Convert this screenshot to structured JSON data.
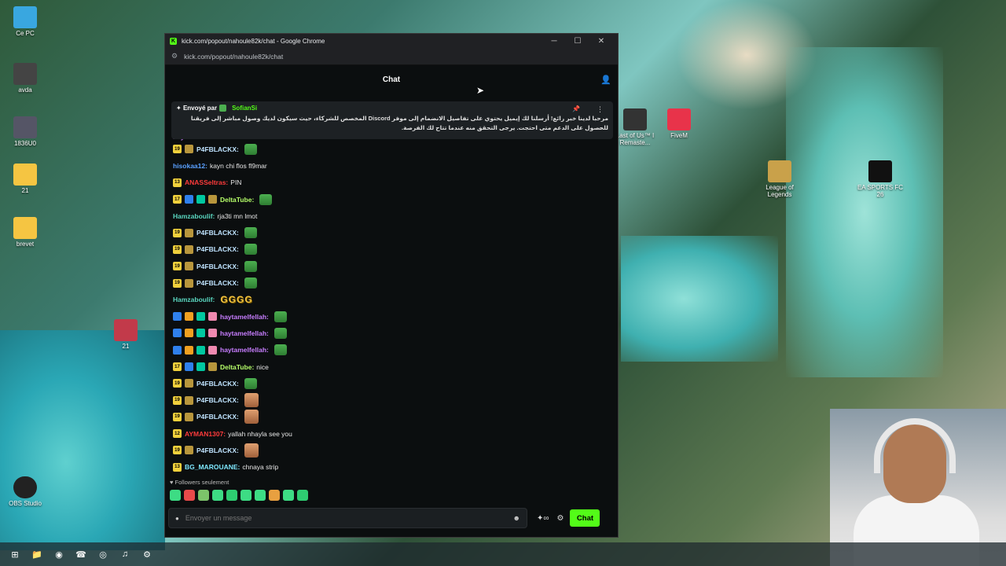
{
  "window": {
    "title": "kick.com/popout/nahoule82k/chat - Google Chrome",
    "url": "kick.com/popout/nahoule82k/chat",
    "minimize": "─",
    "maximize": "☐",
    "close": "✕"
  },
  "chat": {
    "header": "Chat",
    "pinned": {
      "label": "Envoyé par",
      "author": "SofianSi",
      "message": "مرحبا لدينا خبر رائع! أرسلنا لك إيميل يحتوي على تفاصيل الانضمام إلى موفر Discord المخصص للشركاء، حيث سيكون لديك وصول مباشر إلى فريقنا للحصول على الدعم متى احتجت. يرجى التحقق منه عندما تتاح لك الفرصة."
    },
    "partial_top_user": "haytamelfellah:",
    "messages": [
      {
        "user": "P4FBLACKX:",
        "text": "",
        "color": "#bfe3ff",
        "badges": [
          "b-sub:19",
          "b-leaf:"
        ],
        "emote": "pepe"
      },
      {
        "user": "hisokaa12:",
        "text": "kayn chi flos fl9mar",
        "color": "#5aa0ff",
        "badges": [],
        "emote": ""
      },
      {
        "user": "ANASSeltras:",
        "text": "PIN",
        "color": "#ff3b3b",
        "badges": [
          "b-sub:13"
        ],
        "emote": ""
      },
      {
        "user": "DeltaTube:",
        "text": "",
        "color": "#b6ff6a",
        "badges": [
          "b-sub:17",
          "b-ax:",
          "b-mod:",
          "b-leaf:"
        ],
        "emote": "pepe"
      },
      {
        "user": "Hamzaboulif:",
        "text": "rja3ti mn lmot",
        "color": "#5ad7c0",
        "badges": [],
        "emote": ""
      },
      {
        "user": "P4FBLACKX:",
        "text": "",
        "color": "#bfe3ff",
        "badges": [
          "b-sub:19",
          "b-leaf:"
        ],
        "emote": "pepe"
      },
      {
        "user": "P4FBLACKX:",
        "text": "",
        "color": "#bfe3ff",
        "badges": [
          "b-sub:19",
          "b-leaf:"
        ],
        "emote": "pepe"
      },
      {
        "user": "P4FBLACKX:",
        "text": "",
        "color": "#bfe3ff",
        "badges": [
          "b-sub:19",
          "b-leaf:"
        ],
        "emote": "pepe"
      },
      {
        "user": "P4FBLACKX:",
        "text": "",
        "color": "#bfe3ff",
        "badges": [
          "b-sub:19",
          "b-leaf:"
        ],
        "emote": "pepe"
      },
      {
        "user": "Hamzaboulif:",
        "text": "",
        "color": "#5ad7c0",
        "badges": [],
        "emote": "gggg",
        "emote_text": "GGGG"
      },
      {
        "user": "haytamelfellah:",
        "text": "",
        "color": "#c77dff",
        "badges": [
          "b-ax:",
          "b-crown:",
          "b-mod:",
          "b-gift:"
        ],
        "emote": "pepe"
      },
      {
        "user": "haytamelfellah:",
        "text": "",
        "color": "#c77dff",
        "badges": [
          "b-ax:",
          "b-crown:",
          "b-mod:",
          "b-gift:"
        ],
        "emote": "pepe"
      },
      {
        "user": "haytamelfellah:",
        "text": "",
        "color": "#c77dff",
        "badges": [
          "b-ax:",
          "b-crown:",
          "b-mod:",
          "b-gift:"
        ],
        "emote": "pepe"
      },
      {
        "user": "DeltaTube:",
        "text": "nice",
        "color": "#b6ff6a",
        "badges": [
          "b-sub:17",
          "b-ax:",
          "b-mod:",
          "b-leaf:"
        ],
        "emote": ""
      },
      {
        "user": "P4FBLACKX:",
        "text": "",
        "color": "#bfe3ff",
        "badges": [
          "b-sub:19",
          "b-leaf:"
        ],
        "emote": "pepe"
      },
      {
        "user": "P4FBLACKX:",
        "text": "",
        "color": "#bfe3ff",
        "badges": [
          "b-sub:19",
          "b-leaf:"
        ],
        "emote": "face"
      },
      {
        "user": "P4FBLACKX:",
        "text": "",
        "color": "#bfe3ff",
        "badges": [
          "b-sub:19",
          "b-leaf:"
        ],
        "emote": "face"
      },
      {
        "user": "AYMAN1307:",
        "text": "yallah nhayla see you",
        "color": "#ff3b3b",
        "badges": [
          "b-sub:12"
        ],
        "emote": ""
      },
      {
        "user": "P4FBLACKX:",
        "text": "",
        "color": "#bfe3ff",
        "badges": [
          "b-sub:19",
          "b-leaf:"
        ],
        "emote": "face"
      },
      {
        "user": "BG_MAROUANE:",
        "text": "chnaya strip",
        "color": "#7ee8ff",
        "badges": [
          "b-sub:13"
        ],
        "emote": ""
      }
    ],
    "followers_only": "Followers seulement",
    "input_placeholder": "Envoyer un message",
    "chat_button": "Chat",
    "emote_colors": [
      "#3ddc84",
      "#e84a4a",
      "#7cc36a",
      "#3ddc84",
      "#2ecc71",
      "#3ddc84",
      "#3ddc84",
      "#e8a040",
      "#3ddc84",
      "#2ecc71"
    ]
  },
  "desktop": {
    "icons": [
      {
        "label": "Ce PC",
        "color": "#39a7e0"
      },
      {
        "label": "avda",
        "color": "#444"
      },
      {
        "label": "1836U0",
        "color": "#556"
      },
      {
        "label": "21",
        "color": "#f5c542"
      },
      {
        "label": "brevet",
        "color": "#f5c542"
      },
      {
        "label": "21",
        "color": "#c23a4a"
      },
      {
        "label": "OBS Studio",
        "color": "#222"
      },
      {
        "label": "Last of Us™ I Remaste...",
        "color": "#333"
      },
      {
        "label": "FiveM",
        "color": "#e8334a"
      },
      {
        "label": "League of Legends",
        "color": "#c9a14a"
      },
      {
        "label": "EA SPORTS FC 26",
        "color": "#111"
      }
    ]
  },
  "taskbar": {
    "icons": [
      "⊞",
      "📁",
      "◉",
      "☎",
      "◎",
      "♫",
      "⚙"
    ]
  },
  "colors": {
    "accent": "#53fc18",
    "bg": "#0b0e0f"
  }
}
